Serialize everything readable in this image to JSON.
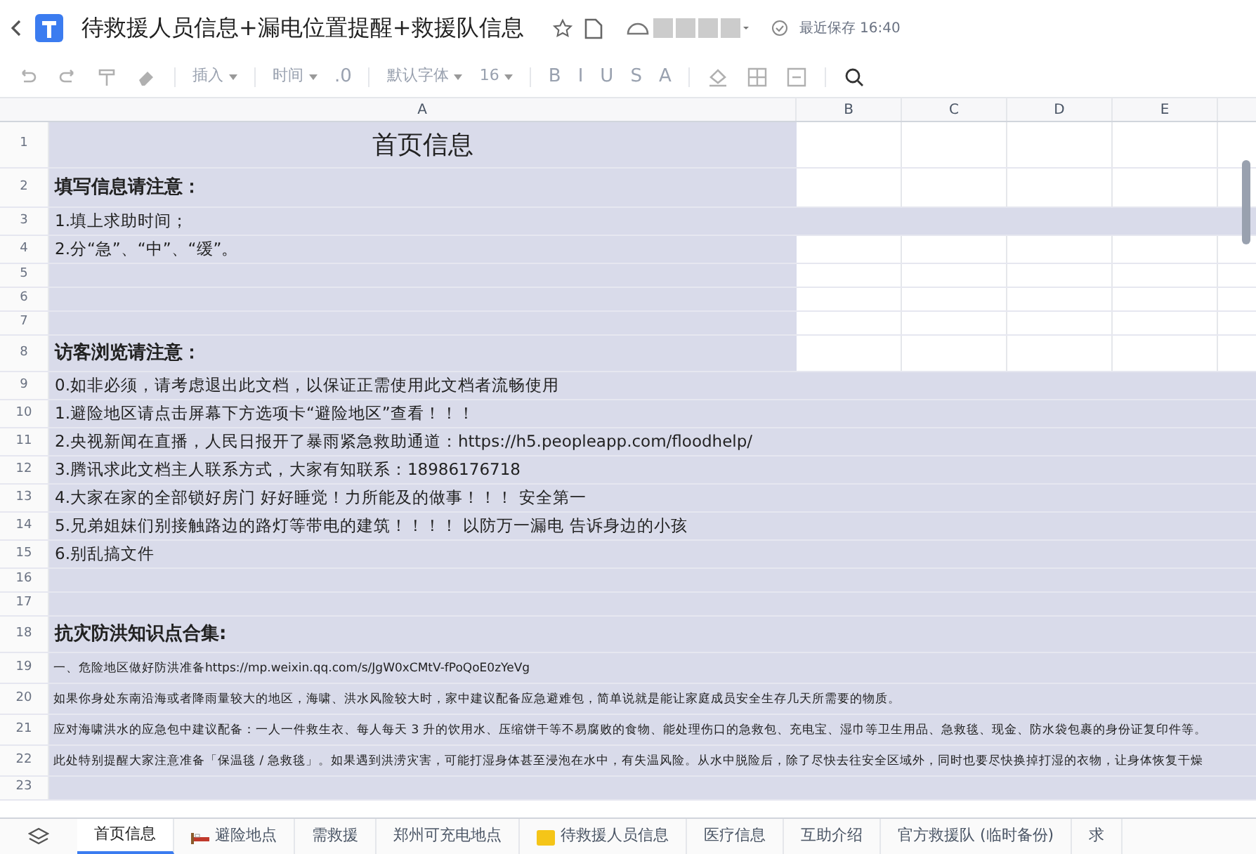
{
  "header": {
    "title": "待救援人员信息+漏电位置提醒+救援队信息",
    "save_status": "最近保存 16:40"
  },
  "toolbar": {
    "disabled": true,
    "items": [
      {
        "kind": "icon"
      },
      {
        "kind": "icon"
      },
      {
        "kind": "icon"
      },
      {
        "kind": "icon"
      },
      {
        "kind": "sep"
      },
      {
        "kind": "dropdown",
        "label": "插入"
      },
      {
        "kind": "sep"
      },
      {
        "kind": "dropdown",
        "label": "时间"
      },
      {
        "kind": "text",
        "label": ".0"
      },
      {
        "kind": "sep"
      },
      {
        "kind": "dropdown",
        "label": "默认字体"
      },
      {
        "kind": "dropdown",
        "label": "16"
      },
      {
        "kind": "sep"
      },
      {
        "kind": "text",
        "label": "B"
      },
      {
        "kind": "text",
        "label": "I"
      },
      {
        "kind": "text",
        "label": "U"
      },
      {
        "kind": "text",
        "label": "S"
      },
      {
        "kind": "text",
        "label": "A"
      },
      {
        "kind": "sep"
      },
      {
        "kind": "icon"
      },
      {
        "kind": "icon"
      },
      {
        "kind": "icon"
      },
      {
        "kind": "sep"
      },
      {
        "kind": "search"
      }
    ]
  },
  "columns": [
    "A",
    "B",
    "C",
    "D",
    "E"
  ],
  "rows": [
    {
      "num": "1",
      "kind": "title",
      "text": "首页信息",
      "row_highlight": false
    },
    {
      "num": "2",
      "kind": "heading",
      "text": "填写信息请注意：",
      "row_highlight": false
    },
    {
      "num": "3",
      "kind": "body",
      "text": "1.填上求助时间；",
      "row_highlight": true
    },
    {
      "num": "4",
      "kind": "body",
      "text": "2.分“急”、“中”、“缓”。",
      "row_highlight": false
    },
    {
      "num": "5",
      "kind": "empty",
      "row_highlight": false
    },
    {
      "num": "6",
      "kind": "empty",
      "row_highlight": false
    },
    {
      "num": "7",
      "kind": "empty",
      "row_highlight": false
    },
    {
      "num": "8",
      "kind": "heading",
      "text": "访客浏览请注意：",
      "row_highlight": false
    },
    {
      "num": "9",
      "kind": "body",
      "text": "0.如非必须，请考虑退出此文档，以保证正需使用此文档者流畅使用",
      "row_highlight": true
    },
    {
      "num": "10",
      "kind": "body",
      "text": "1.避险地区请点击屏幕下方选项卡“避险地区”查看！！！",
      "row_highlight": true
    },
    {
      "num": "11",
      "kind": "body",
      "text": "2.央视新闻在直播，人民日报开了暴雨紧急救助通道：https://h5.peopleapp.com/floodhelp/",
      "row_highlight": true
    },
    {
      "num": "12",
      "kind": "body",
      "text": "3.腾讯求此文档主人联系方式，大家有知联系：18986176718",
      "row_highlight": true
    },
    {
      "num": "13",
      "kind": "body",
      "text": "4.大家在家的全部锁好房门 好好睡觉！力所能及的做事！！！ 安全第一",
      "row_highlight": true
    },
    {
      "num": "14",
      "kind": "body",
      "text": "5.兄弟姐妹们别接触路边的路灯等带电的建筑！！！！ 以防万一漏电 告诉身边的小孩",
      "row_highlight": true
    },
    {
      "num": "15",
      "kind": "body",
      "text": "6.别乱搞文件",
      "row_highlight": true
    },
    {
      "num": "16",
      "kind": "empty",
      "row_highlight": true
    },
    {
      "num": "17",
      "kind": "empty",
      "row_highlight": true
    },
    {
      "num": "18",
      "kind": "heading",
      "text": "抗灾防洪知识点合集:",
      "row_highlight": true
    },
    {
      "num": "19",
      "kind": "small",
      "text": "一、危险地区做好防洪准备https://mp.weixin.qq.com/s/JgW0xCMtV-fPoQoE0zYeVg",
      "row_highlight": true
    },
    {
      "num": "20",
      "kind": "small",
      "text": "如果你身处东南沿海或者降雨量较大的地区，海啸、洪水风险较大时，家中建议配备应急避难包，简单说就是能让家庭成员安全生存几天所需要的物质。",
      "row_highlight": true
    },
    {
      "num": "21",
      "kind": "small",
      "text": "应对海啸洪水的应急包中建议配备：一人一件救生衣、每人每天 3 升的饮用水、压缩饼干等不易腐败的食物、能处理伤口的急救包、充电宝、湿巾等卫生用品、急救毯、现金、防水袋包裹的身份证复印件等。",
      "row_highlight": true
    },
    {
      "num": "22",
      "kind": "small",
      "text": "此处特别提醒大家注意准备「保温毯 / 急救毯」。如果遇到洪涝灾害，可能打湿身体甚至浸泡在水中，有失温风险。从水中脱险后，除了尽快去往安全区域外，同时也要尽快换掉打湿的衣物，让身体恢复干燥",
      "row_highlight": true
    },
    {
      "num": "23",
      "kind": "empty",
      "row_highlight": true
    }
  ],
  "sheet_tabs": [
    {
      "label": "首页信息",
      "selected": true
    },
    {
      "label": "避险地点",
      "selected": false,
      "kind": "with_icon"
    },
    {
      "label": "需救援",
      "selected": false
    },
    {
      "label": "郑州可充电地点",
      "selected": false
    },
    {
      "label": "待救援人员信息",
      "selected": false,
      "kind": "with_icon"
    },
    {
      "label": "医疗信息",
      "selected": false
    },
    {
      "label": "互助介绍",
      "selected": false
    },
    {
      "label": "官方救援队 (临时备份)",
      "selected": false
    },
    {
      "label": "求",
      "selected": false
    }
  ]
}
